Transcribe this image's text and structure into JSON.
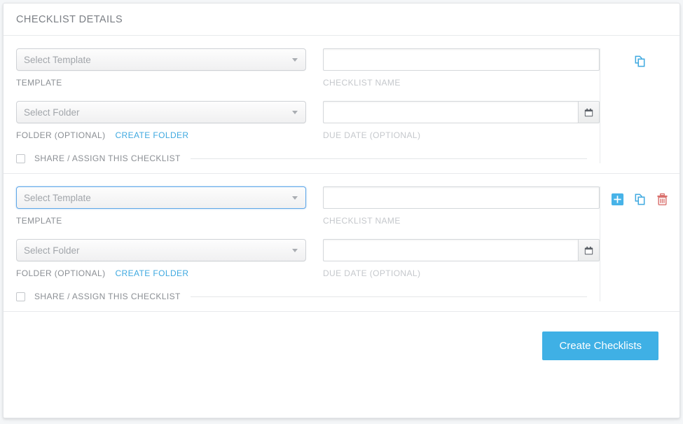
{
  "header": {
    "title": "CHECKLIST DETAILS"
  },
  "colors": {
    "accent": "#3fb0e5",
    "link": "#3fa9e0",
    "danger": "#d9534f",
    "focus_border": "#60a7e8",
    "label": "#8b8f94",
    "label_light": "#c5c8cc"
  },
  "labels": {
    "template": "TEMPLATE",
    "checklist_name": "CHECKLIST NAME",
    "folder_optional": "FOLDER (OPTIONAL)",
    "create_folder": "CREATE FOLDER",
    "due_date_optional": "DUE DATE (OPTIONAL)",
    "share_assign": "SHARE / ASSIGN THIS CHECKLIST"
  },
  "rows": [
    {
      "template_select": {
        "value": "Select Template",
        "focused": false
      },
      "name_input": {
        "value": "",
        "placeholder": ""
      },
      "folder_select": {
        "value": "Select Folder",
        "focused": false
      },
      "due_date_input": {
        "value": "",
        "placeholder": ""
      },
      "share_checked": false,
      "actions": [
        "copy-icon"
      ]
    },
    {
      "template_select": {
        "value": "Select Template",
        "focused": true
      },
      "name_input": {
        "value": "",
        "placeholder": ""
      },
      "folder_select": {
        "value": "Select Folder",
        "focused": false
      },
      "due_date_input": {
        "value": "",
        "placeholder": ""
      },
      "share_checked": false,
      "actions": [
        "add-icon",
        "copy-icon",
        "delete-icon"
      ]
    }
  ],
  "footer": {
    "submit_label": "Create Checklists"
  }
}
